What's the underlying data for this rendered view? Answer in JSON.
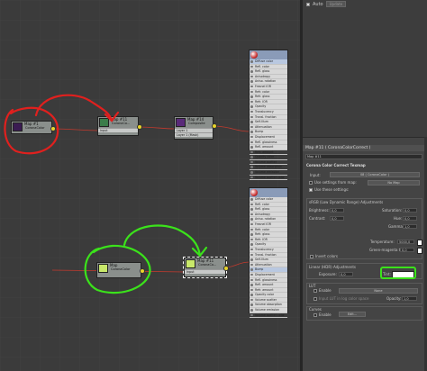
{
  "editor": {
    "node_corona_left": {
      "title": "Map #1",
      "subtitle": "CoronaColor"
    },
    "node_ccc_top": {
      "title": "Map #11",
      "subtitle": "CoronaCo...",
      "slot": "Input"
    },
    "node_composite": {
      "title": "Map #14",
      "subtitle": "Composite",
      "slots": [
        "Layer 1",
        "Layer 1 (Mask)"
      ]
    },
    "node_corona_bottom": {
      "title": "Map",
      "subtitle": "CoronaColor"
    },
    "node_ccc_bottom": {
      "title": "Map #11",
      "subtitle": "CoronaCo...",
      "slot": "Input"
    },
    "material_slots": [
      "Diffuse color",
      "Refl. color",
      "Refl. gloss",
      "Anisotropy",
      "Aniso. rotation",
      "Fresnel IOR",
      "Refr. color",
      "Refr. gloss",
      "Refr. IOR",
      "Opacity",
      "Translucency",
      "Transl. fraction",
      "Self-Illum",
      "Attenuation",
      "Bump",
      "Displacement",
      "Refl. glossiness",
      "Refl. amount",
      "Refr. amount",
      "Opacity color",
      "Volume scatter",
      "Volume absorption",
      "Volume emission",
      "Volume scatter color"
    ]
  },
  "panel": {
    "auto_label": "Auto",
    "update_label": "Update",
    "title_bar": "Map #11 ( CoronaColorCorrect )",
    "map_name": "Map #11",
    "rollout_title": "Corona Color Correct Texmap",
    "input_label": "Input:",
    "input_value": "08 ( CoronaColor )",
    "use_settings_from_map": "Use settings from map:",
    "no_map": "No Map",
    "use_these_settings": "Use these settings:",
    "srgb_title": "sRGB (Low Dynamic Range) Adjustments",
    "brightness_label": "Brightness:",
    "brightness_value": "0,0",
    "saturation_label": "Saturation:",
    "saturation_value": "0,0",
    "contrast_label": "Contrast:",
    "contrast_value": "0,0",
    "hue_label": "Hue:",
    "hue_value": "0,0",
    "gamma_label": "Gamma:",
    "gamma_value": "1,0",
    "temperature_label": "Temperature:",
    "temperature_value": "5000,0",
    "green_magenta_label": "Green-magenta tint:",
    "green_magenta_value": "0,0",
    "invert_colors": "Invert colors",
    "linear_title": "Linear (HDR) Adjustments",
    "exposure_label": "Exposure:",
    "exposure_value": "0,0",
    "tint_label": "Tint:",
    "lut_title": "LUT",
    "enable_label": "Enable",
    "none_label": "None",
    "log_space_label": "Input LUT in log color space",
    "opacity_label": "Opacity:",
    "opacity_value": "1,0",
    "curves_title": "Curves",
    "edit_label": "Edit..."
  },
  "colors": {
    "annotation_red": "#e0201e",
    "annotation_green": "#3be21b",
    "node_swatch_green": "#3b7d4a",
    "port_yellow": "#e8d42a"
  }
}
